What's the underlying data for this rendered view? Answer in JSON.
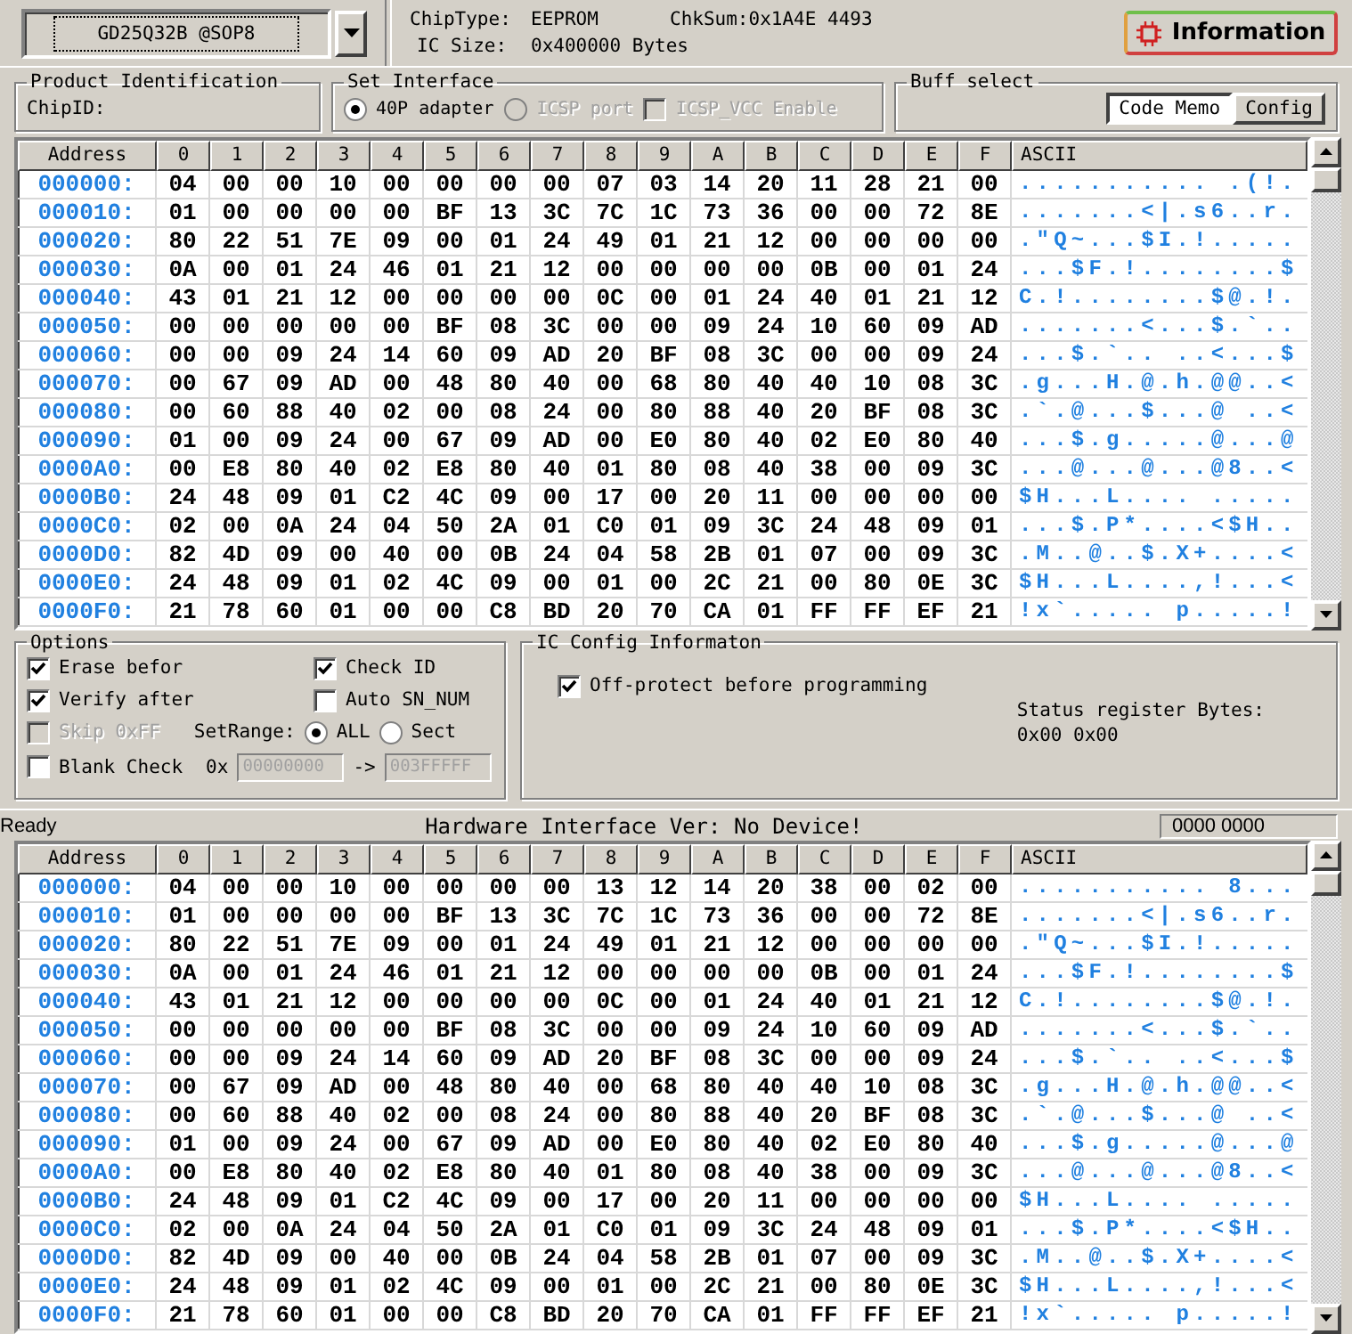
{
  "device_selector": {
    "value": "GD25Q32B @SOP8"
  },
  "chip_info": {
    "chip_type_label": "ChipType:",
    "chip_type": "EEPROM",
    "checksum": "ChkSum:0x1A4E 4493",
    "ic_size_label": "IC Size:",
    "ic_size": "0x400000 Bytes"
  },
  "information_button": {
    "label": "Information"
  },
  "product_identification": {
    "title": "Product Identification",
    "chip_id_label": "ChipID:"
  },
  "set_interface": {
    "title": "Set Interface",
    "options": [
      {
        "kind": "radio",
        "label": "40P adapter",
        "selected": true,
        "disabled": false
      },
      {
        "kind": "radio",
        "label": "ICSP port",
        "selected": false,
        "disabled": true
      },
      {
        "kind": "checkbox",
        "label": "ICSP_VCC Enable",
        "checked": false,
        "disabled": true
      }
    ]
  },
  "buff_select": {
    "title": "Buff select",
    "buttons": [
      {
        "label": "Code Memo",
        "selected": true
      },
      {
        "label": "Config",
        "selected": false
      }
    ]
  },
  "memory_view_top": {
    "columns": [
      "Address",
      "0",
      "1",
      "2",
      "3",
      "4",
      "5",
      "6",
      "7",
      "8",
      "9",
      "A",
      "B",
      "C",
      "D",
      "E",
      "F",
      "ASCII"
    ],
    "rows": [
      {
        "address": "000000:",
        "bytes": [
          "04",
          "00",
          "00",
          "10",
          "00",
          "00",
          "00",
          "00",
          "07",
          "03",
          "14",
          "20",
          "11",
          "28",
          "21",
          "00"
        ],
        "ascii": "........... .(!."
      },
      {
        "address": "000010:",
        "bytes": [
          "01",
          "00",
          "00",
          "00",
          "00",
          "BF",
          "13",
          "3C",
          "7C",
          "1C",
          "73",
          "36",
          "00",
          "00",
          "72",
          "8E"
        ],
        "ascii": ".......<|.s6..r."
      },
      {
        "address": "000020:",
        "bytes": [
          "80",
          "22",
          "51",
          "7E",
          "09",
          "00",
          "01",
          "24",
          "49",
          "01",
          "21",
          "12",
          "00",
          "00",
          "00",
          "00"
        ],
        "ascii": ".\"Q~...$I.!....."
      },
      {
        "address": "000030:",
        "bytes": [
          "0A",
          "00",
          "01",
          "24",
          "46",
          "01",
          "21",
          "12",
          "00",
          "00",
          "00",
          "00",
          "0B",
          "00",
          "01",
          "24"
        ],
        "ascii": "...$F.!........$"
      },
      {
        "address": "000040:",
        "bytes": [
          "43",
          "01",
          "21",
          "12",
          "00",
          "00",
          "00",
          "00",
          "0C",
          "00",
          "01",
          "24",
          "40",
          "01",
          "21",
          "12"
        ],
        "ascii": "C.!........$@.!."
      },
      {
        "address": "000050:",
        "bytes": [
          "00",
          "00",
          "00",
          "00",
          "00",
          "BF",
          "08",
          "3C",
          "00",
          "00",
          "09",
          "24",
          "10",
          "60",
          "09",
          "AD"
        ],
        "ascii": ".......<...$.`.."
      },
      {
        "address": "000060:",
        "bytes": [
          "00",
          "00",
          "09",
          "24",
          "14",
          "60",
          "09",
          "AD",
          "20",
          "BF",
          "08",
          "3C",
          "00",
          "00",
          "09",
          "24"
        ],
        "ascii": "...$.`.. ..<...$"
      },
      {
        "address": "000070:",
        "bytes": [
          "00",
          "67",
          "09",
          "AD",
          "00",
          "48",
          "80",
          "40",
          "00",
          "68",
          "80",
          "40",
          "40",
          "10",
          "08",
          "3C"
        ],
        "ascii": ".g...H.@.h.@@..<"
      },
      {
        "address": "000080:",
        "bytes": [
          "00",
          "60",
          "88",
          "40",
          "02",
          "00",
          "08",
          "24",
          "00",
          "80",
          "88",
          "40",
          "20",
          "BF",
          "08",
          "3C"
        ],
        "ascii": ".`.@...$...@ ..<"
      },
      {
        "address": "000090:",
        "bytes": [
          "01",
          "00",
          "09",
          "24",
          "00",
          "67",
          "09",
          "AD",
          "00",
          "E0",
          "80",
          "40",
          "02",
          "E0",
          "80",
          "40"
        ],
        "ascii": "...$.g.....@...@"
      },
      {
        "address": "0000A0:",
        "bytes": [
          "00",
          "E8",
          "80",
          "40",
          "02",
          "E8",
          "80",
          "40",
          "01",
          "80",
          "08",
          "40",
          "38",
          "00",
          "09",
          "3C"
        ],
        "ascii": "...@...@...@8..<"
      },
      {
        "address": "0000B0:",
        "bytes": [
          "24",
          "48",
          "09",
          "01",
          "C2",
          "4C",
          "09",
          "00",
          "17",
          "00",
          "20",
          "11",
          "00",
          "00",
          "00",
          "00"
        ],
        "ascii": "$H...L.... ....."
      },
      {
        "address": "0000C0:",
        "bytes": [
          "02",
          "00",
          "0A",
          "24",
          "04",
          "50",
          "2A",
          "01",
          "C0",
          "01",
          "09",
          "3C",
          "24",
          "48",
          "09",
          "01"
        ],
        "ascii": "...$.P*....<$H.."
      },
      {
        "address": "0000D0:",
        "bytes": [
          "82",
          "4D",
          "09",
          "00",
          "40",
          "00",
          "0B",
          "24",
          "04",
          "58",
          "2B",
          "01",
          "07",
          "00",
          "09",
          "3C"
        ],
        "ascii": ".M..@..$.X+....<"
      },
      {
        "address": "0000E0:",
        "bytes": [
          "24",
          "48",
          "09",
          "01",
          "02",
          "4C",
          "09",
          "00",
          "01",
          "00",
          "2C",
          "21",
          "00",
          "80",
          "0E",
          "3C"
        ],
        "ascii": "$H...L....,!...<"
      },
      {
        "address": "0000F0:",
        "bytes": [
          "21",
          "78",
          "60",
          "01",
          "00",
          "00",
          "C8",
          "BD",
          "20",
          "70",
          "CA",
          "01",
          "FF",
          "FF",
          "EF",
          "21"
        ],
        "ascii": "!x`..... p.....!"
      }
    ]
  },
  "options": {
    "title": "Options",
    "items": [
      {
        "label": "Erase befor",
        "checked": true,
        "disabled": false
      },
      {
        "label": "Check ID",
        "checked": true,
        "disabled": false
      },
      {
        "label": "Verify after",
        "checked": true,
        "disabled": false
      },
      {
        "label": "Auto SN_NUM",
        "checked": false,
        "disabled": false
      },
      {
        "label": "Skip 0xFF",
        "checked": false,
        "disabled": true
      },
      {
        "label": "Blank Check",
        "checked": false,
        "disabled": false
      }
    ],
    "set_range": {
      "label": "SetRange:",
      "choices": [
        {
          "label": "ALL",
          "selected": true
        },
        {
          "label": "Sect",
          "selected": false
        }
      ],
      "prefix": "0x",
      "start": "00000000",
      "arrow": "->",
      "end": "003FFFFF",
      "disabled": true
    }
  },
  "ic_config": {
    "title": "IC Config Informaton",
    "off_protect": {
      "label": "Off-protect before programming",
      "checked": true
    },
    "status_label": "Status register Bytes:",
    "status_value": "0x00 0x00"
  },
  "status_bar": {
    "state": "Ready",
    "message": "Hardware Interface Ver: No Device!",
    "counter": "0000 0000"
  },
  "memory_view_bottom": {
    "columns": [
      "Address",
      "0",
      "1",
      "2",
      "3",
      "4",
      "5",
      "6",
      "7",
      "8",
      "9",
      "A",
      "B",
      "C",
      "D",
      "E",
      "F",
      "ASCII"
    ],
    "rows": [
      {
        "address": "000000:",
        "bytes": [
          "04",
          "00",
          "00",
          "10",
          "00",
          "00",
          "00",
          "00",
          "13",
          "12",
          "14",
          "20",
          "38",
          "00",
          "02",
          "00"
        ],
        "ascii": "........... 8..."
      },
      {
        "address": "000010:",
        "bytes": [
          "01",
          "00",
          "00",
          "00",
          "00",
          "BF",
          "13",
          "3C",
          "7C",
          "1C",
          "73",
          "36",
          "00",
          "00",
          "72",
          "8E"
        ],
        "ascii": ".......<|.s6..r."
      },
      {
        "address": "000020:",
        "bytes": [
          "80",
          "22",
          "51",
          "7E",
          "09",
          "00",
          "01",
          "24",
          "49",
          "01",
          "21",
          "12",
          "00",
          "00",
          "00",
          "00"
        ],
        "ascii": ".\"Q~...$I.!....."
      },
      {
        "address": "000030:",
        "bytes": [
          "0A",
          "00",
          "01",
          "24",
          "46",
          "01",
          "21",
          "12",
          "00",
          "00",
          "00",
          "00",
          "0B",
          "00",
          "01",
          "24"
        ],
        "ascii": "...$F.!........$"
      },
      {
        "address": "000040:",
        "bytes": [
          "43",
          "01",
          "21",
          "12",
          "00",
          "00",
          "00",
          "00",
          "0C",
          "00",
          "01",
          "24",
          "40",
          "01",
          "21",
          "12"
        ],
        "ascii": "C.!........$@.!."
      },
      {
        "address": "000050:",
        "bytes": [
          "00",
          "00",
          "00",
          "00",
          "00",
          "BF",
          "08",
          "3C",
          "00",
          "00",
          "09",
          "24",
          "10",
          "60",
          "09",
          "AD"
        ],
        "ascii": ".......<...$.`.."
      },
      {
        "address": "000060:",
        "bytes": [
          "00",
          "00",
          "09",
          "24",
          "14",
          "60",
          "09",
          "AD",
          "20",
          "BF",
          "08",
          "3C",
          "00",
          "00",
          "09",
          "24"
        ],
        "ascii": "...$.`.. ..<...$"
      },
      {
        "address": "000070:",
        "bytes": [
          "00",
          "67",
          "09",
          "AD",
          "00",
          "48",
          "80",
          "40",
          "00",
          "68",
          "80",
          "40",
          "40",
          "10",
          "08",
          "3C"
        ],
        "ascii": ".g...H.@.h.@@..<"
      },
      {
        "address": "000080:",
        "bytes": [
          "00",
          "60",
          "88",
          "40",
          "02",
          "00",
          "08",
          "24",
          "00",
          "80",
          "88",
          "40",
          "20",
          "BF",
          "08",
          "3C"
        ],
        "ascii": ".`.@...$...@ ..<"
      },
      {
        "address": "000090:",
        "bytes": [
          "01",
          "00",
          "09",
          "24",
          "00",
          "67",
          "09",
          "AD",
          "00",
          "E0",
          "80",
          "40",
          "02",
          "E0",
          "80",
          "40"
        ],
        "ascii": "...$.g.....@...@"
      },
      {
        "address": "0000A0:",
        "bytes": [
          "00",
          "E8",
          "80",
          "40",
          "02",
          "E8",
          "80",
          "40",
          "01",
          "80",
          "08",
          "40",
          "38",
          "00",
          "09",
          "3C"
        ],
        "ascii": "...@...@...@8..<"
      },
      {
        "address": "0000B0:",
        "bytes": [
          "24",
          "48",
          "09",
          "01",
          "C2",
          "4C",
          "09",
          "00",
          "17",
          "00",
          "20",
          "11",
          "00",
          "00",
          "00",
          "00"
        ],
        "ascii": "$H...L.... ....."
      },
      {
        "address": "0000C0:",
        "bytes": [
          "02",
          "00",
          "0A",
          "24",
          "04",
          "50",
          "2A",
          "01",
          "C0",
          "01",
          "09",
          "3C",
          "24",
          "48",
          "09",
          "01"
        ],
        "ascii": "...$.P*....<$H.."
      },
      {
        "address": "0000D0:",
        "bytes": [
          "82",
          "4D",
          "09",
          "00",
          "40",
          "00",
          "0B",
          "24",
          "04",
          "58",
          "2B",
          "01",
          "07",
          "00",
          "09",
          "3C"
        ],
        "ascii": ".M..@..$.X+....<"
      },
      {
        "address": "0000E0:",
        "bytes": [
          "24",
          "48",
          "09",
          "01",
          "02",
          "4C",
          "09",
          "00",
          "01",
          "00",
          "2C",
          "21",
          "00",
          "80",
          "0E",
          "3C"
        ],
        "ascii": "$H...L....,!...<"
      },
      {
        "address": "0000F0:",
        "bytes": [
          "21",
          "78",
          "60",
          "01",
          "00",
          "00",
          "C8",
          "BD",
          "20",
          "70",
          "CA",
          "01",
          "FF",
          "FF",
          "EF",
          "21"
        ],
        "ascii": "!x`..... p.....!"
      }
    ]
  }
}
